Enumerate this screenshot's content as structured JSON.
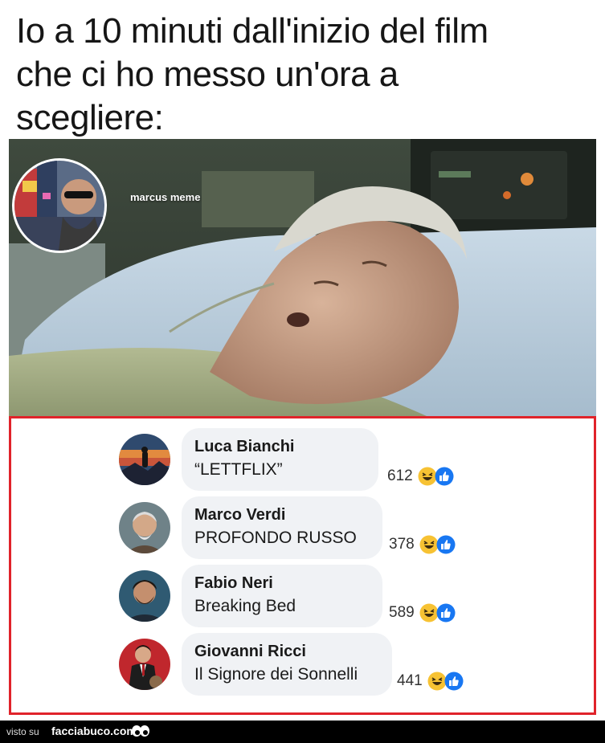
{
  "caption": {
    "line1": "Io a 10 minuti dall'inizio del film",
    "line2": "che ci ho messo un'ora a",
    "line3": "scegliere:"
  },
  "watermark": {
    "name": "marcus meme"
  },
  "comments": [
    {
      "author": "Luca Bianchi",
      "text": "“LETTFLIX”",
      "count": "612"
    },
    {
      "author": "Marco Verdi",
      "text": "PROFONDO RUSSO",
      "count": "378"
    },
    {
      "author": "Fabio Neri",
      "text": "Breaking Bed",
      "count": "589"
    },
    {
      "author": "Giovanni Ricci",
      "text": "Il Signore dei Sonnelli",
      "count": "441"
    }
  ],
  "colors": {
    "highlight_border": "#e0232a",
    "bubble": "#f0f2f5",
    "like_blue": "#1877f2",
    "haha_yellow": "#f7c233"
  },
  "icons": [
    "haha-emoji-icon",
    "like-thumb-icon",
    "eyes-icon"
  ],
  "footer": {
    "prefix": "visto su",
    "site": "facciabuco.com"
  }
}
